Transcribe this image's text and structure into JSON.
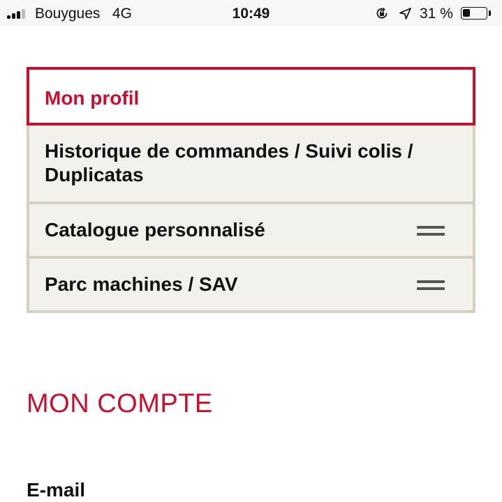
{
  "status_bar": {
    "carrier": "Bouygues",
    "network": "4G",
    "time": "10:49",
    "battery_percent": "31 %",
    "battery_level": 0.31,
    "signal_bars_active": 3,
    "icons": [
      "signal-icon",
      "rotation-lock-icon",
      "location-arrow-icon",
      "battery-icon"
    ]
  },
  "menu": {
    "items": [
      {
        "label": "Mon profil",
        "active": true
      },
      {
        "label": "Historique de commandes / Suivi colis / Duplicatas",
        "active": false
      },
      {
        "label": "Catalogue personnalisé",
        "active": false,
        "icon": "hamburger-icon"
      },
      {
        "label": "Parc machines / SAV",
        "active": false,
        "icon": "hamburger-icon"
      }
    ]
  },
  "section": {
    "title": "MON COMPTE",
    "field_label": "E-mail"
  },
  "colors": {
    "accent": "#c8102e",
    "menu_bg": "#f3f1ec",
    "menu_border": "#d8d0bf"
  }
}
